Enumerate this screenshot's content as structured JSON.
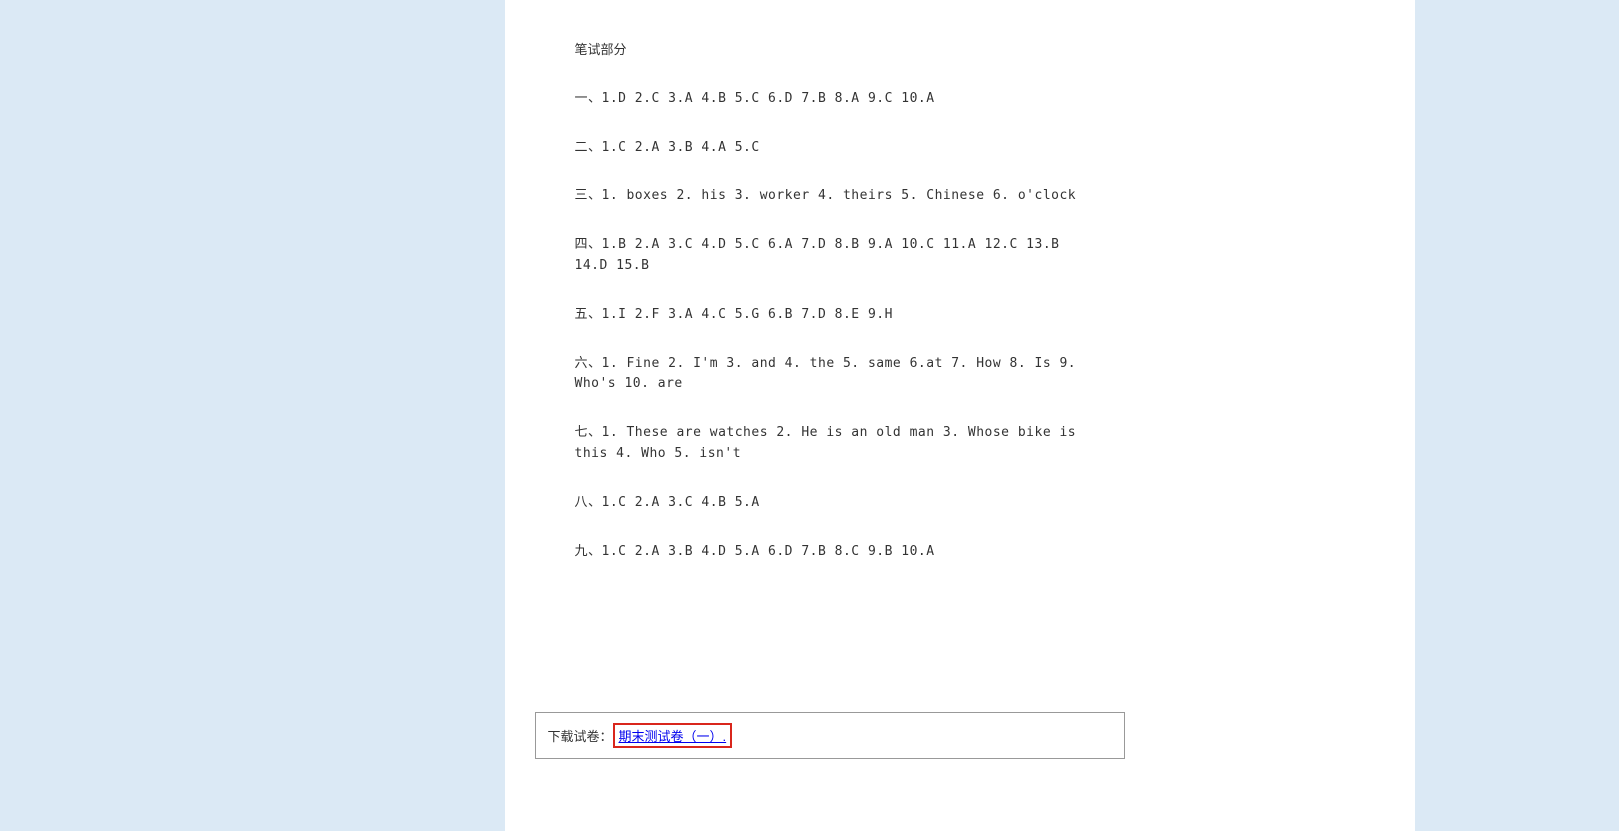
{
  "answers": {
    "title": "笔试部分",
    "lines": [
      "一、1.D 2.C 3.A 4.B 5.C 6.D 7.B 8.A 9.C 10.A",
      "二、1.C 2.A 3.B 4.A 5.C",
      "三、1. boxes 2. his 3. worker 4. theirs 5. Chinese 6. o'clock",
      "四、1.B 2.A 3.C 4.D 5.C 6.A 7.D 8.B 9.A 10.C 11.A 12.C 13.B 14.D 15.B",
      "五、1.I 2.F 3.A 4.C 5.G 6.B 7.D 8.E 9.H",
      "六、1. Fine 2. I'm 3. and 4. the 5. same 6.at 7. How 8. Is 9. Who's 10. are",
      "七、1. These are watches 2. He is an old man 3. Whose bike is this 4. Who 5. isn't",
      "八、1.C 2.A 3.C 4.B 5.A",
      "九、1.C 2.A 3.B 4.D 5.A 6.D 7.B 8.C 9.B 10.A"
    ]
  },
  "download": {
    "label": "下载试卷：",
    "link_text": "期末测试卷（一）."
  }
}
